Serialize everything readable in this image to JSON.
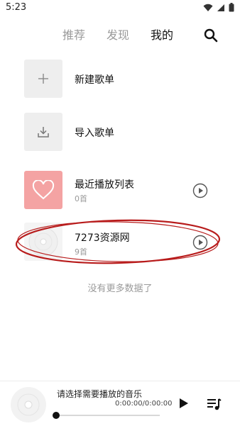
{
  "status_bar": {
    "time": "5:23"
  },
  "tabs": [
    {
      "label": "推荐",
      "active": false
    },
    {
      "label": "发现",
      "active": false
    },
    {
      "label": "我的",
      "active": true
    }
  ],
  "icons": {
    "search": "search-icon",
    "plus": "plus-icon",
    "import": "download-icon",
    "heart": "heart-icon",
    "play": "play-circle-icon",
    "queue": "playlist-icon"
  },
  "actions": {
    "new_playlist": "新建歌单",
    "import_playlist": "导入歌单"
  },
  "playlists": [
    {
      "title": "最近播放列表",
      "count": "0首"
    },
    {
      "title": "7273资源网",
      "count": "9首"
    }
  ],
  "no_more_text": "没有更多数据了",
  "player": {
    "title": "请选择需要播放的音乐",
    "time": "0:00:00/0:00:00",
    "progress": 0
  },
  "colors": {
    "heart_bg": "#f4a3a3",
    "annotation": "#b81c1c",
    "active_tab": "#111111",
    "inactive_tab": "#9a9a9a"
  }
}
